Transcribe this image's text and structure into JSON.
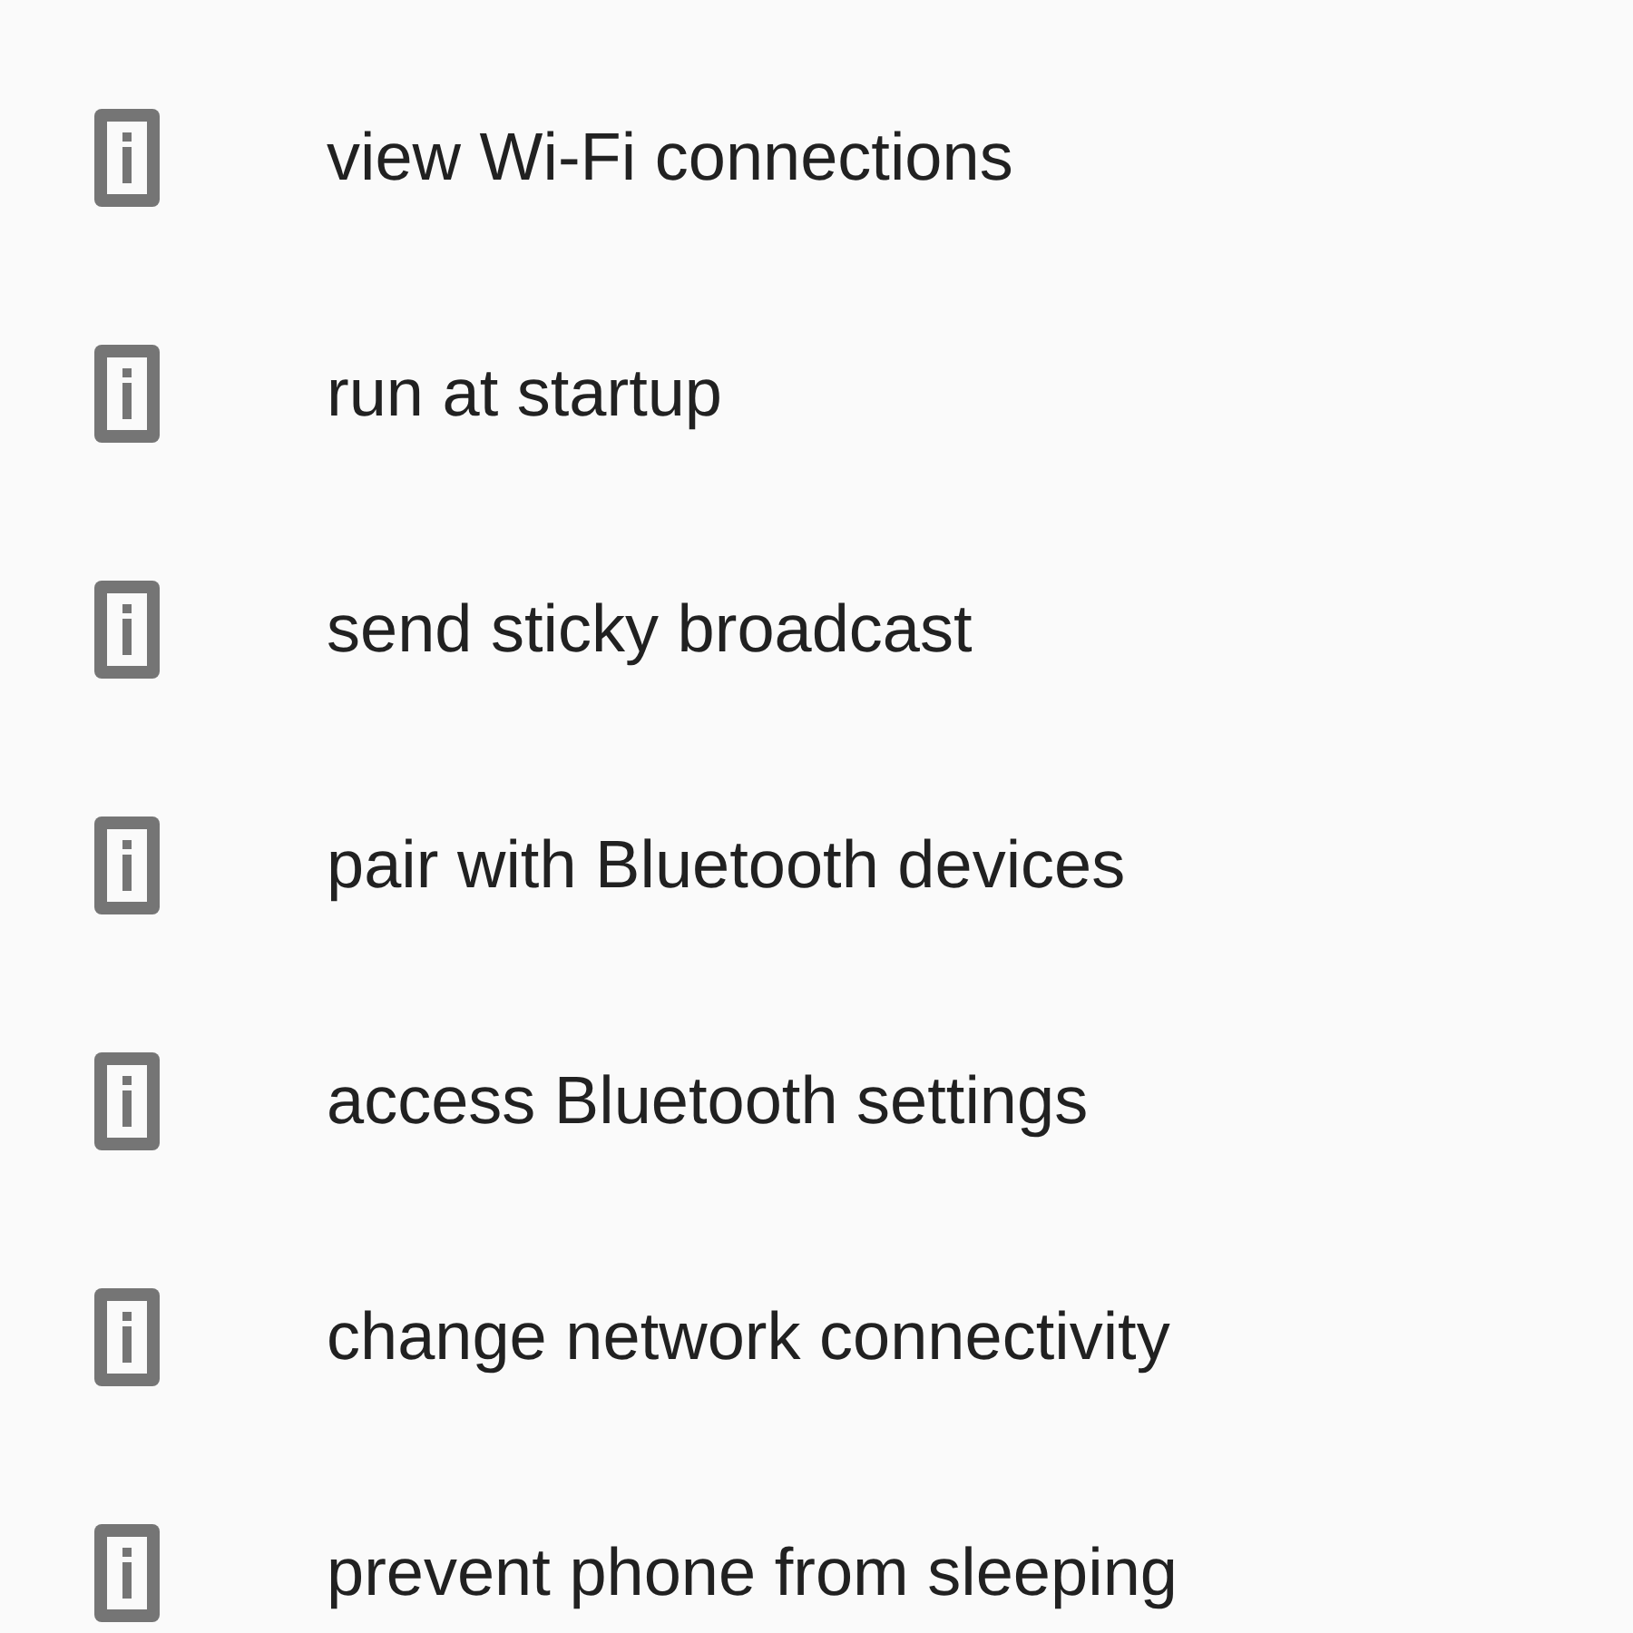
{
  "permissions": [
    {
      "label": "view Wi-Fi connections"
    },
    {
      "label": "run at startup"
    },
    {
      "label": "send sticky broadcast"
    },
    {
      "label": "pair with Bluetooth devices"
    },
    {
      "label": "access Bluetooth settings"
    },
    {
      "label": "change network connectivity"
    },
    {
      "label": "prevent phone from sleeping"
    }
  ]
}
